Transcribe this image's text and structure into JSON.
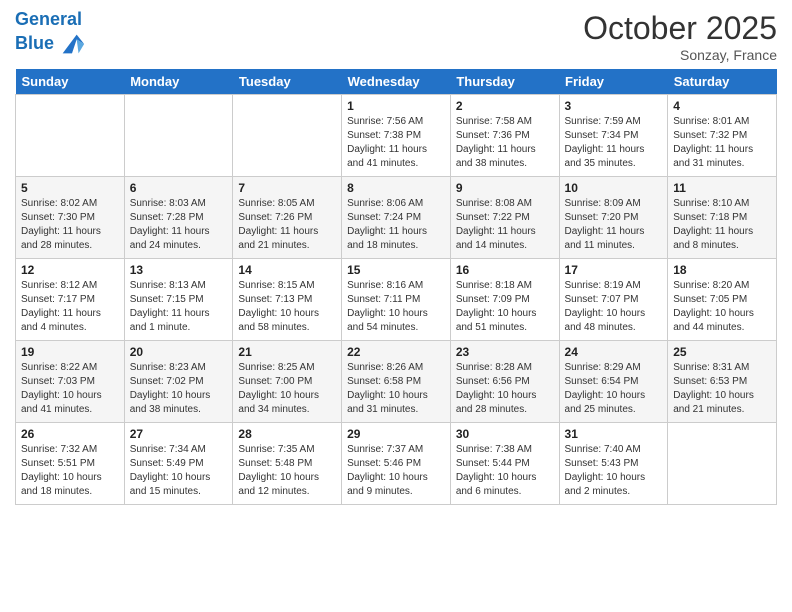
{
  "header": {
    "logo_line1": "General",
    "logo_line2": "Blue",
    "month": "October 2025",
    "location": "Sonzay, France"
  },
  "days_of_week": [
    "Sunday",
    "Monday",
    "Tuesday",
    "Wednesday",
    "Thursday",
    "Friday",
    "Saturday"
  ],
  "weeks": [
    [
      {
        "num": "",
        "info": ""
      },
      {
        "num": "",
        "info": ""
      },
      {
        "num": "",
        "info": ""
      },
      {
        "num": "1",
        "info": "Sunrise: 7:56 AM\nSunset: 7:38 PM\nDaylight: 11 hours\nand 41 minutes."
      },
      {
        "num": "2",
        "info": "Sunrise: 7:58 AM\nSunset: 7:36 PM\nDaylight: 11 hours\nand 38 minutes."
      },
      {
        "num": "3",
        "info": "Sunrise: 7:59 AM\nSunset: 7:34 PM\nDaylight: 11 hours\nand 35 minutes."
      },
      {
        "num": "4",
        "info": "Sunrise: 8:01 AM\nSunset: 7:32 PM\nDaylight: 11 hours\nand 31 minutes."
      }
    ],
    [
      {
        "num": "5",
        "info": "Sunrise: 8:02 AM\nSunset: 7:30 PM\nDaylight: 11 hours\nand 28 minutes."
      },
      {
        "num": "6",
        "info": "Sunrise: 8:03 AM\nSunset: 7:28 PM\nDaylight: 11 hours\nand 24 minutes."
      },
      {
        "num": "7",
        "info": "Sunrise: 8:05 AM\nSunset: 7:26 PM\nDaylight: 11 hours\nand 21 minutes."
      },
      {
        "num": "8",
        "info": "Sunrise: 8:06 AM\nSunset: 7:24 PM\nDaylight: 11 hours\nand 18 minutes."
      },
      {
        "num": "9",
        "info": "Sunrise: 8:08 AM\nSunset: 7:22 PM\nDaylight: 11 hours\nand 14 minutes."
      },
      {
        "num": "10",
        "info": "Sunrise: 8:09 AM\nSunset: 7:20 PM\nDaylight: 11 hours\nand 11 minutes."
      },
      {
        "num": "11",
        "info": "Sunrise: 8:10 AM\nSunset: 7:18 PM\nDaylight: 11 hours\nand 8 minutes."
      }
    ],
    [
      {
        "num": "12",
        "info": "Sunrise: 8:12 AM\nSunset: 7:17 PM\nDaylight: 11 hours\nand 4 minutes."
      },
      {
        "num": "13",
        "info": "Sunrise: 8:13 AM\nSunset: 7:15 PM\nDaylight: 11 hours\nand 1 minute."
      },
      {
        "num": "14",
        "info": "Sunrise: 8:15 AM\nSunset: 7:13 PM\nDaylight: 10 hours\nand 58 minutes."
      },
      {
        "num": "15",
        "info": "Sunrise: 8:16 AM\nSunset: 7:11 PM\nDaylight: 10 hours\nand 54 minutes."
      },
      {
        "num": "16",
        "info": "Sunrise: 8:18 AM\nSunset: 7:09 PM\nDaylight: 10 hours\nand 51 minutes."
      },
      {
        "num": "17",
        "info": "Sunrise: 8:19 AM\nSunset: 7:07 PM\nDaylight: 10 hours\nand 48 minutes."
      },
      {
        "num": "18",
        "info": "Sunrise: 8:20 AM\nSunset: 7:05 PM\nDaylight: 10 hours\nand 44 minutes."
      }
    ],
    [
      {
        "num": "19",
        "info": "Sunrise: 8:22 AM\nSunset: 7:03 PM\nDaylight: 10 hours\nand 41 minutes."
      },
      {
        "num": "20",
        "info": "Sunrise: 8:23 AM\nSunset: 7:02 PM\nDaylight: 10 hours\nand 38 minutes."
      },
      {
        "num": "21",
        "info": "Sunrise: 8:25 AM\nSunset: 7:00 PM\nDaylight: 10 hours\nand 34 minutes."
      },
      {
        "num": "22",
        "info": "Sunrise: 8:26 AM\nSunset: 6:58 PM\nDaylight: 10 hours\nand 31 minutes."
      },
      {
        "num": "23",
        "info": "Sunrise: 8:28 AM\nSunset: 6:56 PM\nDaylight: 10 hours\nand 28 minutes."
      },
      {
        "num": "24",
        "info": "Sunrise: 8:29 AM\nSunset: 6:54 PM\nDaylight: 10 hours\nand 25 minutes."
      },
      {
        "num": "25",
        "info": "Sunrise: 8:31 AM\nSunset: 6:53 PM\nDaylight: 10 hours\nand 21 minutes."
      }
    ],
    [
      {
        "num": "26",
        "info": "Sunrise: 7:32 AM\nSunset: 5:51 PM\nDaylight: 10 hours\nand 18 minutes."
      },
      {
        "num": "27",
        "info": "Sunrise: 7:34 AM\nSunset: 5:49 PM\nDaylight: 10 hours\nand 15 minutes."
      },
      {
        "num": "28",
        "info": "Sunrise: 7:35 AM\nSunset: 5:48 PM\nDaylight: 10 hours\nand 12 minutes."
      },
      {
        "num": "29",
        "info": "Sunrise: 7:37 AM\nSunset: 5:46 PM\nDaylight: 10 hours\nand 9 minutes."
      },
      {
        "num": "30",
        "info": "Sunrise: 7:38 AM\nSunset: 5:44 PM\nDaylight: 10 hours\nand 6 minutes."
      },
      {
        "num": "31",
        "info": "Sunrise: 7:40 AM\nSunset: 5:43 PM\nDaylight: 10 hours\nand 2 minutes."
      },
      {
        "num": "",
        "info": ""
      }
    ]
  ]
}
